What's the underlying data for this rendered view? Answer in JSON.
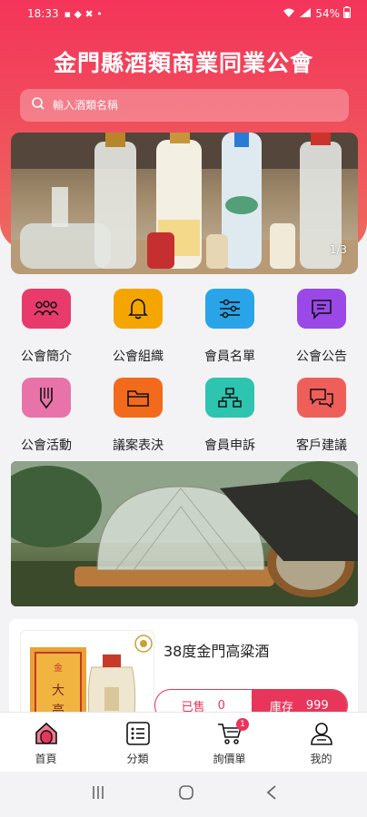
{
  "status_bar": {
    "time": "18:33",
    "battery": "54%"
  },
  "header": {
    "title": "金門縣酒類商業同業公會"
  },
  "search": {
    "placeholder": "輸入酒類名稱"
  },
  "banner": {
    "page_indicator": "1/3"
  },
  "menu": [
    {
      "label": "公會簡介",
      "icon": "people-icon",
      "color": "#e83a6b"
    },
    {
      "label": "公會組織",
      "icon": "bell-icon",
      "color": "#f5a500"
    },
    {
      "label": "會員名單",
      "icon": "sliders-icon",
      "color": "#2aa4e8"
    },
    {
      "label": "公會公告",
      "icon": "message-icon",
      "color": "#9a48e8"
    },
    {
      "label": "公會活動",
      "icon": "pen-icon",
      "color": "#e873a8"
    },
    {
      "label": "議案表決",
      "icon": "folder-icon",
      "color": "#f26a1b"
    },
    {
      "label": "會員申訴",
      "icon": "hierarchy-icon",
      "color": "#2dc4b0"
    },
    {
      "label": "客戶建議",
      "icon": "chat-icon",
      "color": "#ef5f5a"
    }
  ],
  "product": {
    "name": "38度金門高粱酒",
    "sold_label": "已售",
    "sold_value": "0",
    "stock_label": "庫存",
    "stock_value": "999"
  },
  "bottom_nav": [
    {
      "label": "首頁",
      "icon": "home-icon"
    },
    {
      "label": "分類",
      "icon": "list-icon"
    },
    {
      "label": "詢價單",
      "icon": "cart-icon",
      "badge": "1"
    },
    {
      "label": "我的",
      "icon": "user-icon"
    }
  ]
}
